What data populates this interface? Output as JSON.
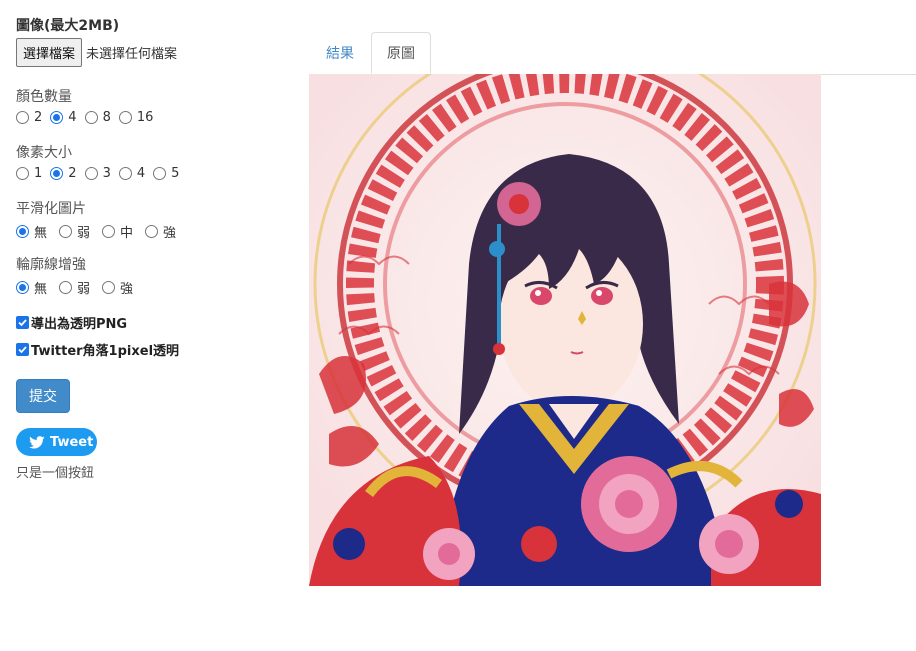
{
  "form": {
    "image": {
      "label": "圖像(最大2MB)",
      "choose_button": "選擇檔案",
      "file_status": "未選擇任何檔案"
    },
    "color_count": {
      "label": "顏色數量",
      "options": [
        "2",
        "4",
        "8",
        "16"
      ],
      "selected": "4"
    },
    "pixel_size": {
      "label": "像素大小",
      "options": [
        "1",
        "2",
        "3",
        "4",
        "5"
      ],
      "selected": "2"
    },
    "smoothing": {
      "label": "平滑化圖片",
      "options": [
        "無",
        "弱",
        "中",
        "強"
      ],
      "selected": "無"
    },
    "outline": {
      "label": "輪廓線增強",
      "options": [
        "無",
        "弱",
        "強"
      ],
      "selected": "無"
    },
    "export_png": {
      "label": "導出為透明PNG",
      "checked": true
    },
    "twitter_corner": {
      "label": "Twitter角落1pixel透明",
      "checked": true
    },
    "submit_label": "提交"
  },
  "social": {
    "tweet_label": "Tweet",
    "note": "只是一個按鈕"
  },
  "tabs": {
    "result": "結果",
    "original": "原圖",
    "active": "原圖"
  },
  "image_panel": {
    "icon": "anime-girl-illustration",
    "colors": {
      "background": "#fbe9ea",
      "red": "#d8323a",
      "navy": "#1d2a8a",
      "pink": "#e36b9a",
      "gold": "#e2b53a",
      "hair": "#3a2a4a",
      "skin": "#fbe7df"
    }
  }
}
